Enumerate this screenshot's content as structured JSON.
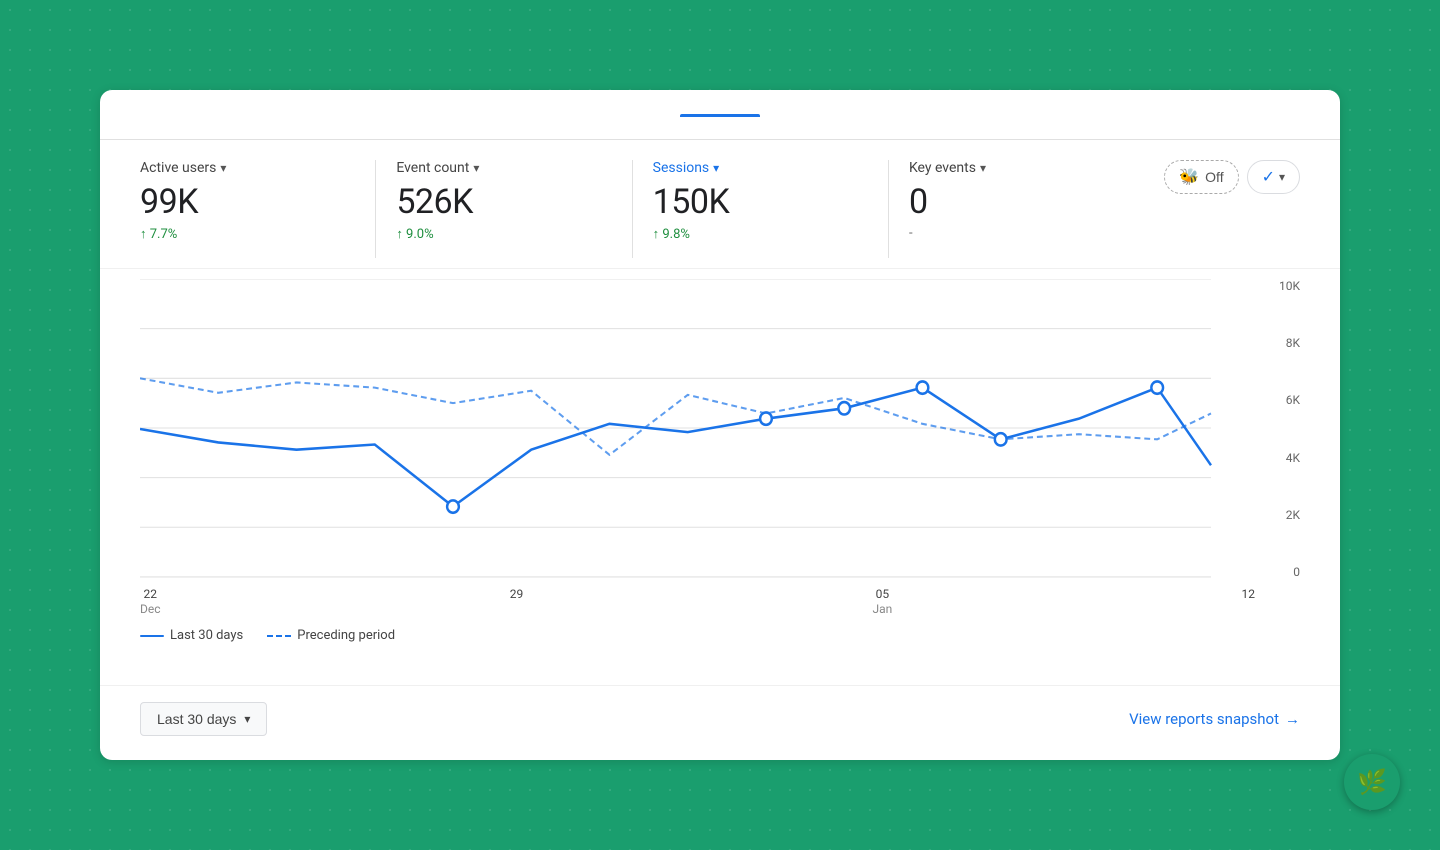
{
  "metrics": [
    {
      "id": "active-users",
      "label": "Active users",
      "value": "99K",
      "change": "↑ 7.7%",
      "active": false
    },
    {
      "id": "event-count",
      "label": "Event count",
      "value": "526K",
      "change": "↑ 9.0%",
      "active": false
    },
    {
      "id": "sessions",
      "label": "Sessions",
      "value": "150K",
      "change": "↑ 9.8%",
      "active": true
    },
    {
      "id": "key-events",
      "label": "Key events",
      "value": "0",
      "change": "-",
      "active": false
    }
  ],
  "toggle": {
    "label": "Off",
    "bee": "🐝"
  },
  "chart": {
    "yLabels": [
      "10K",
      "8K",
      "6K",
      "4K",
      "2K",
      "0"
    ],
    "xLabels": [
      {
        "date": "22",
        "month": "Dec"
      },
      {
        "date": "29",
        "month": ""
      },
      {
        "date": "05",
        "month": "Jan"
      },
      {
        "date": "12",
        "month": ""
      }
    ]
  },
  "legend": {
    "solidLabel": "Last 30 days",
    "dashedLabel": "Preceding period"
  },
  "dateRange": {
    "label": "Last 30 days"
  },
  "viewReports": {
    "label": "View reports snapshot",
    "arrow": "→"
  }
}
